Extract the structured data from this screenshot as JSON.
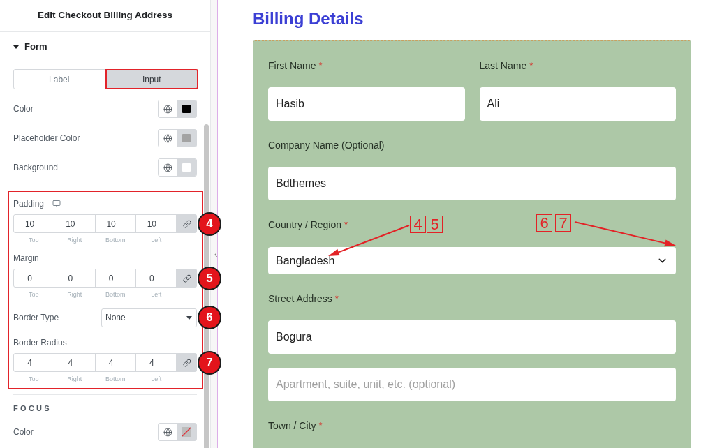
{
  "panel": {
    "title": "Edit Checkout Billing Address",
    "section": {
      "title": "Form",
      "expanded": true
    },
    "tabs": [
      {
        "label": "Label",
        "selected": false,
        "highlighted": false
      },
      {
        "label": "Input",
        "selected": true,
        "highlighted": true
      }
    ],
    "colors": [
      {
        "label": "Color",
        "color": "#000000"
      },
      {
        "label": "Placeholder Color",
        "color": "#a3a3a3"
      },
      {
        "label": "Background",
        "color": "#ffffff"
      }
    ],
    "spacing": {
      "highlighted": true,
      "controls": [
        {
          "kind": "dimensions",
          "label": "Padding",
          "responsive": true,
          "linked": true,
          "marker": "4",
          "fields": [
            {
              "value": "10",
              "caption": "Top"
            },
            {
              "value": "10",
              "caption": "Right"
            },
            {
              "value": "10",
              "caption": "Bottom"
            },
            {
              "value": "10",
              "caption": "Left"
            }
          ]
        },
        {
          "kind": "dimensions",
          "label": "Margin",
          "responsive": false,
          "linked": true,
          "marker": "5",
          "fields": [
            {
              "value": "0",
              "caption": "Top"
            },
            {
              "value": "0",
              "caption": "Right"
            },
            {
              "value": "0",
              "caption": "Bottom"
            },
            {
              "value": "0",
              "caption": "Left"
            }
          ]
        },
        {
          "kind": "select",
          "label": "Border Type",
          "value": "None",
          "marker": "6"
        },
        {
          "kind": "dimensions",
          "label": "Border Radius",
          "responsive": false,
          "linked": true,
          "marker": "7",
          "fields": [
            {
              "value": "4",
              "caption": "Top"
            },
            {
              "value": "4",
              "caption": "Right"
            },
            {
              "value": "4",
              "caption": "Bottom"
            },
            {
              "value": "4",
              "caption": "Left"
            }
          ]
        }
      ]
    },
    "focus": {
      "title": "FOCUS",
      "colors": [
        {
          "label": "Color",
          "cleared": true
        }
      ]
    }
  },
  "preview": {
    "heading": "Billing Details",
    "rows": [
      {
        "fields": [
          {
            "kind": "input",
            "label": "First Name",
            "required_mark": "*",
            "value": "Hasib"
          },
          {
            "kind": "input",
            "label": "Last Name",
            "required_mark": "*",
            "value": "Ali"
          }
        ]
      },
      {
        "fields": [
          {
            "kind": "input",
            "label": "Company Name (Optional)",
            "value": "Bdthemes"
          }
        ]
      },
      {
        "fields": [
          {
            "kind": "select",
            "label": "Country / Region",
            "required_mark": "*",
            "value": "Bangladesh"
          }
        ]
      },
      {
        "fields": [
          {
            "kind": "input",
            "label": "Street Address",
            "required_mark": "*",
            "value": "Bogura"
          }
        ]
      },
      {
        "fields": [
          {
            "kind": "input",
            "placeholder": "Apartment, suite, unit, etc. (optional)"
          }
        ]
      },
      {
        "fields": [
          {
            "kind": "label",
            "label": "Town / City",
            "required_mark": "*"
          }
        ]
      }
    ],
    "callouts": [
      {
        "numbers": [
          "4",
          "5"
        ]
      },
      {
        "numbers": [
          "6",
          "7"
        ]
      }
    ]
  }
}
